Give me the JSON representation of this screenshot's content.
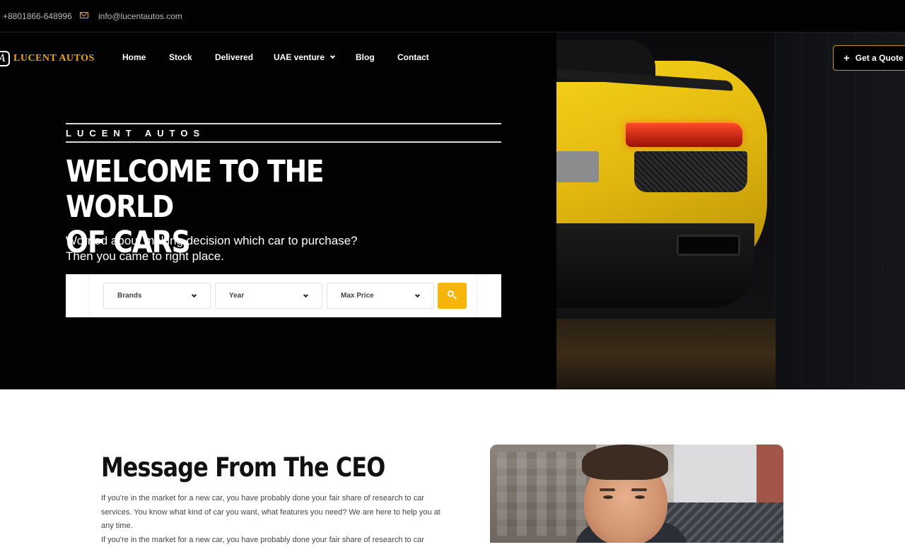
{
  "topbar": {
    "phone": "+8801866-648996",
    "email": "info@lucentautos.com",
    "email_icon": "envelope-icon"
  },
  "brand": {
    "name": "LUCENT AUTOS",
    "accent": "#e9a813"
  },
  "nav": {
    "items": [
      {
        "label": "Home"
      },
      {
        "label": "Stock"
      },
      {
        "label": "Delivered"
      },
      {
        "label": "UAE venture",
        "has_dropdown": true
      },
      {
        "label": "Blog"
      },
      {
        "label": "Contact"
      }
    ],
    "cta_icon": "plus-icon",
    "cta_label": "Get a Quote"
  },
  "hero": {
    "kicker": "LUCENT AUTOS",
    "title_line1": "WELCOME TO THE WORLD",
    "title_line2": "OF CARS",
    "subtitle_line1": "Worried about making decision which car to purchase?",
    "subtitle_line2": "Then you came to right place.",
    "image": "yellow-sports-car-rear"
  },
  "search": {
    "brands_label": "Brands",
    "year_label": "Year",
    "max_price_label": "Max Price",
    "button_icon": "search-icon",
    "button_color": "#f5b50a"
  },
  "ceo": {
    "title": "Message From The CEO",
    "paragraph1": "If you're in the market for a new car, you have probably done your fair share of research to car services. You know what kind of car you want, what features you need? We are here to help you at any time.",
    "paragraph2": "If you're in the market for a new car, you have probably done your fair share of research to car",
    "photo": "ceo-portrait"
  }
}
